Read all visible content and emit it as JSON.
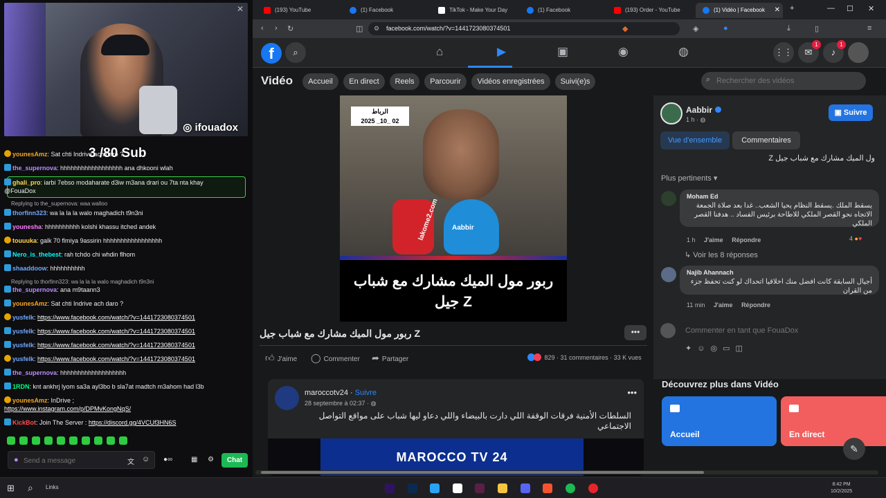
{
  "stream": {
    "handle": "ifouadox",
    "sub_goal": "3 /80 Sub",
    "chat_messages": [
      {
        "user": "younesAmz",
        "color": "#f5a623",
        "text": "Sat chti Indrive ach daro ?"
      },
      {
        "user": "the_supernova",
        "color": "#b78cff",
        "text": "hhhhhhhhhhhhhhhhhh ana dhkooni wlah"
      },
      {
        "user": "ghali_pro",
        "color": "#ffd84d",
        "text": "iarbi 7ebso modaharate d3iw m3ana drari ou 7ta nta khay",
        "text2": "@FouaDox"
      },
      {
        "reply": "Replying to the_supernova: waa walloo"
      },
      {
        "user": "thorfinn323",
        "color": "#6fa8ff",
        "text": "wa la la la walo maghadich t9n3ni"
      },
      {
        "user": "younesha",
        "color": "#ff7aff",
        "text": "hhhhhhhhhh kolshi khassu itched andek"
      },
      {
        "user": "touuuka",
        "color": "#ffd84d",
        "text": "galk 70 flmiya 9assirin hhhhhhhhhhhhhhhhh"
      },
      {
        "user": "Nero_is_thebest",
        "color": "#00ffff",
        "text": "rah tchdo chi whdin flhom"
      },
      {
        "user": "shaaddoow",
        "color": "#6fa8ff",
        "text": "hhhhhhhhhh"
      },
      {
        "reply": "Replying to thorfinn323: wa la la la walo maghadich t9n3ni"
      },
      {
        "user": "the_supernova",
        "color": "#b78cff",
        "text": "ana m9taann3"
      },
      {
        "user": "younesAmz",
        "color": "#f5a623",
        "text": "Sat chti Indrive ach daro ?"
      },
      {
        "user": "yusfelk",
        "color": "#6fa8ff",
        "link": "https://www.facebook.com/watch/?v=1441723080374501"
      },
      {
        "user": "yusfelk",
        "color": "#6fa8ff",
        "link": "https://www.facebook.com/watch/?v=1441723080374501"
      },
      {
        "user": "yusfelk",
        "color": "#6fa8ff",
        "link": "https://www.facebook.com/watch/?v=1441723080374501"
      },
      {
        "user": "yusfelk",
        "color": "#6fa8ff",
        "link": "https://www.facebook.com/watch/?v=1441723080374501"
      },
      {
        "user": "the_supernova",
        "color": "#b78cff",
        "text": "hhhhhhhhhhhhhhhhhhh"
      },
      {
        "user": "1RDN",
        "color": "#00ff7f",
        "text": "knt ankhrj lyom sa3a ayl3bo b sla7at madtch m3ahom had l3b"
      },
      {
        "user": "younesAmz",
        "color": "#f5a623",
        "text": "InDrive ;",
        "link": "https://www.instagram.com/p/DPMvKongNqS/"
      },
      {
        "user": "KickBot",
        "color": "#ff4d4d",
        "text": "Join The Server :",
        "link": "https://discord.gg/4VCUf3HN6S"
      }
    ],
    "send_placeholder": "Send a message",
    "chat_button": "Chat"
  },
  "browser": {
    "tabs": [
      {
        "label": "(193) YouTube",
        "icon_color": "#ff0000"
      },
      {
        "label": "(1) Facebook",
        "icon_color": "#1877f2"
      },
      {
        "label": "TikTok - Make Your Day",
        "icon_color": "#ffffff"
      },
      {
        "label": "(1) Facebook",
        "icon_color": "#1877f2"
      },
      {
        "label": "(193) Order - YouTube",
        "icon_color": "#ff0000"
      },
      {
        "label": "(1) Vidéo | Facebook",
        "icon_color": "#1877f2",
        "active": true
      }
    ],
    "url": "facebook.com/watch/?v=1441723080374501"
  },
  "facebook": {
    "notifications_messenger": "1",
    "notifications_bell": "1",
    "video_section_title": "Vidéo",
    "nav_pills": [
      "Accueil",
      "En direct",
      "Reels",
      "Parcourir",
      "Vidéos enregistrées",
      "Suivi(e)s"
    ],
    "search_placeholder": "Rechercher des vidéos",
    "video": {
      "location_tag": "الرباط",
      "date_tag": "2025 _10_ 02",
      "logo_left": "lakome2.com",
      "logo_right": "Aabbir",
      "caption_line1": "ربور مول الميك مشارك مع شباب",
      "caption_line2": "جيل Z",
      "title": "ربور مول الميك مشارك مع شباب جيل Z",
      "like": "J'aime",
      "comment": "Commenter",
      "share": "Partager",
      "reactions_count": "829",
      "comments_count": "31 commentaires",
      "views": "33 K vues"
    },
    "side": {
      "author": "Aabbir",
      "time": "1 h · ",
      "follow": "Suivre",
      "tab_overview": "Vue d'ensemble",
      "tab_comments": "Commentaires",
      "caption": "ول الميك مشارك مع شباب جيل Z",
      "sort": "Plus pertinents",
      "comments": [
        {
          "name": "Moham Ed",
          "text": "يسقط الملك .يسقط النظام يحيا الشعب.. غدا بعد صلاة الجمعة الاتجاه نحو القصر الملكي للاطاحة برئيس الفساد .. هدفنا القصر الملكي",
          "time": "1 h",
          "like": "J'aime",
          "reply": "Répondre",
          "reactions": "4"
        },
        {
          "name": "Najib Ahannach",
          "text": "أجيال السابقة كانت افضل منك اخلاقيا اتحداك لو كنت تحفظ جزء من القران",
          "time": "11 min",
          "like": "J'aime",
          "reply": "Répondre"
        }
      ],
      "see_replies": "Voir les 8 réponses",
      "comment_placeholder": "Commenter en tant que FouaDox"
    },
    "post2": {
      "page": "maroccotv24",
      "follow": "Suivre",
      "date": "28 septembre à 02:37 · ",
      "text": "السلطات الأمنية فرقات الوقفة اللي دارت بالبيضاء واللي دعاو ليها شباب على مواقع التواصل الاجتماعي",
      "banner": "MAROCCO TV 24"
    },
    "discover": {
      "title": "Découvrez plus dans Vidéo",
      "cards": [
        {
          "label": "Accueil",
          "color": "#2374e1"
        },
        {
          "label": "En direct",
          "color": "#f25e5e"
        }
      ]
    }
  },
  "taskbar": {
    "links": "Links",
    "time": "8:42 PM",
    "date": "10/2/2025"
  }
}
